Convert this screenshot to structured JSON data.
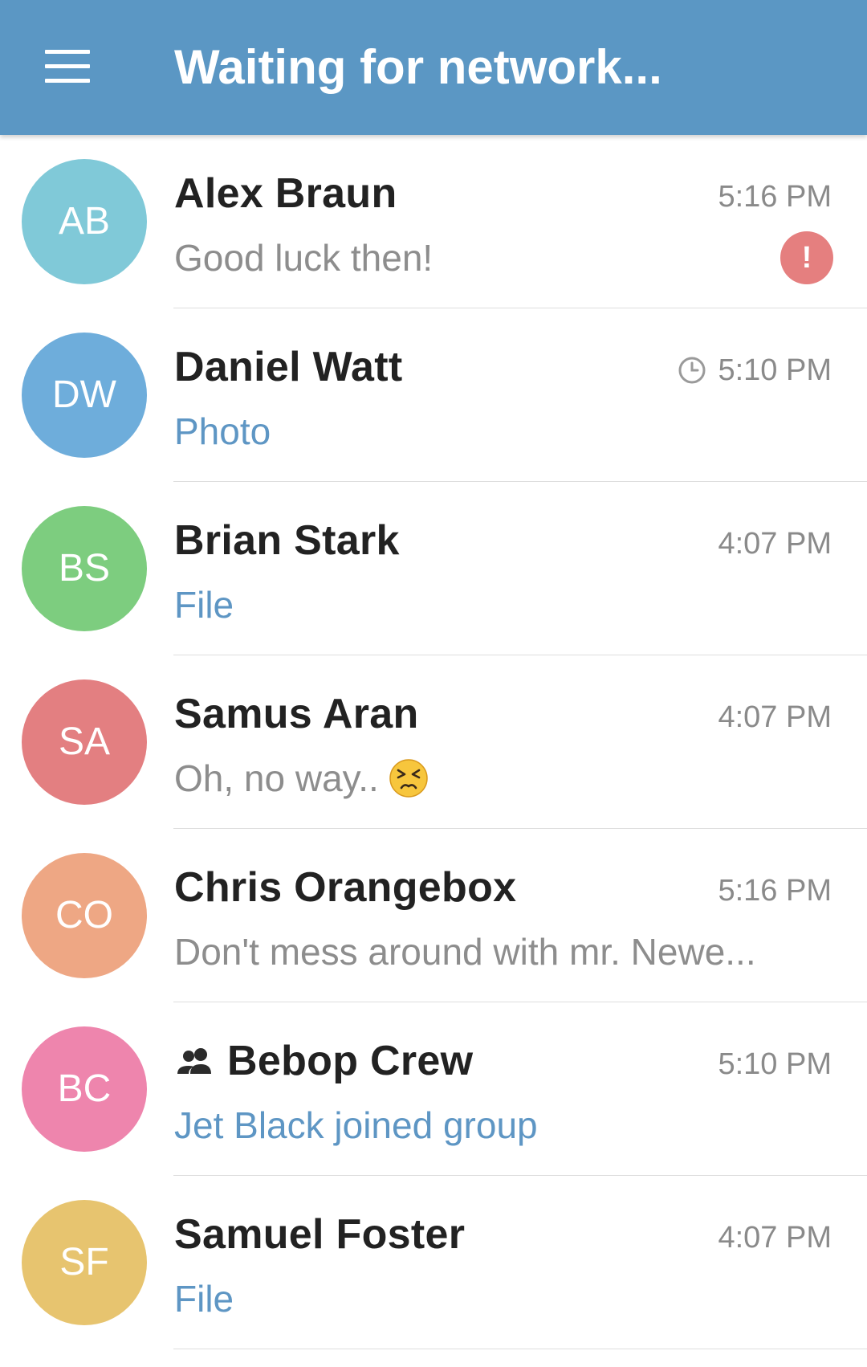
{
  "header": {
    "title": "Waiting for network...",
    "background": "#5b97c4",
    "menu_icon": "hamburger-menu-icon"
  },
  "chats": [
    {
      "initials": "AB",
      "avatar_color": "#80c9d8",
      "name": "Alex Braun",
      "time": "5:16 PM",
      "preview": "Good luck then!",
      "preview_style": "gray",
      "status_badge": "!",
      "status_badge_icon": "error-alert-icon"
    },
    {
      "initials": "DW",
      "avatar_color": "#6eaddb",
      "name": "Daniel Watt",
      "time": "5:10 PM",
      "time_icon": "clock-pending-icon",
      "preview": "Photo",
      "preview_style": "blue"
    },
    {
      "initials": "BS",
      "avatar_color": "#7dcd7f",
      "name": "Brian Stark",
      "time": "4:07 PM",
      "preview": "File",
      "preview_style": "blue"
    },
    {
      "initials": "SA",
      "avatar_color": "#e37f81",
      "name": "Samus Aran",
      "time": "4:07 PM",
      "preview": "Oh, no way..",
      "preview_style": "gray",
      "preview_emoji": "persevering-face-emoji-icon"
    },
    {
      "initials": "CO",
      "avatar_color": "#eea784",
      "name": "Chris Orangebox",
      "time": "5:16 PM",
      "preview": "Don't mess around with mr. Newe...",
      "preview_style": "gray"
    },
    {
      "initials": "BC",
      "avatar_color": "#ee85ad",
      "name": "Bebop Crew",
      "name_icon": "group-icon",
      "time": "5:10 PM",
      "preview": "Jet Black joined group",
      "preview_style": "blue"
    },
    {
      "initials": "SF",
      "avatar_color": "#e7c46f",
      "name": "Samuel Foster",
      "time": "4:07 PM",
      "preview": "File",
      "preview_style": "blue"
    }
  ]
}
